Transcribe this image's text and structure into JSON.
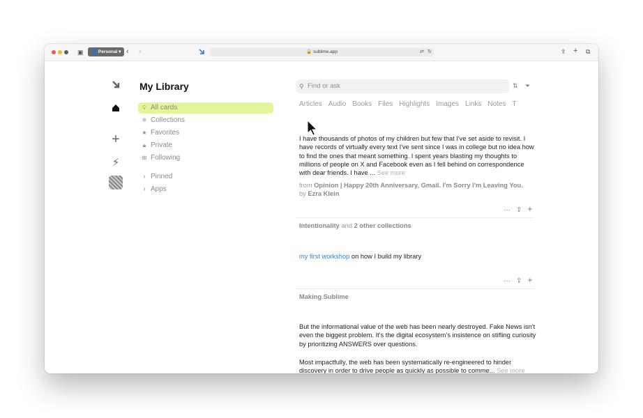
{
  "browser": {
    "profile_label": "Personal",
    "url": "sublime.app"
  },
  "sidebar": {
    "title": "My Library",
    "items": [
      {
        "label": "All cards",
        "icon": "bulb-icon"
      },
      {
        "label": "Collections",
        "icon": "collections-icon"
      },
      {
        "label": "Favorites",
        "icon": "star-icon"
      },
      {
        "label": "Private",
        "icon": "lock-icon"
      },
      {
        "label": "Following",
        "icon": "following-icon"
      },
      {
        "label": "Pinned",
        "icon": "chevron-right-icon"
      },
      {
        "label": "Apps",
        "icon": "chevron-right-icon"
      }
    ]
  },
  "search": {
    "placeholder": "Find or ask"
  },
  "tabs": [
    "Articles",
    "Audio",
    "Books",
    "Files",
    "Highlights",
    "Images",
    "Links",
    "Notes",
    "T"
  ],
  "cards": [
    {
      "text": "I have thousands of photos of my children but few that I've set aside to revisit. I have records of virtually every text I've sent since I was in college but no idea how to find the ones that meant something. I spent years blasting my thoughts to millions of people on X and Facebook even as I fell behind on correspondence with dear friends. I have ...",
      "see_more": "See more",
      "from_prefix": "from",
      "from_title": "Opinion | Happy 20th Anniversary, Gmail. I'm Sorry I'm Leaving You.",
      "by_prefix": "by",
      "author": "Ezra Klein",
      "collection": "Intentionality",
      "collection_sep": "and",
      "collection_more": "2 other collections"
    },
    {
      "link_text": "my first workshop",
      "text": "on how I build my library",
      "collection": "Making Sublime"
    },
    {
      "text1": "But the informational value of the web has been nearly destroyed. Fake News isn't even the biggest problem. It's the digital ecosystem's insistence on stifling curiosity by prioritizing ANSWERS over questions.",
      "text2": "Most impactfully, the web has been systematically re-engineered to hinder discovery in order to drive people as quickly as possible to comme...",
      "see_more": "See more"
    }
  ],
  "card_actions": [
    "···",
    "⇪",
    "+"
  ]
}
